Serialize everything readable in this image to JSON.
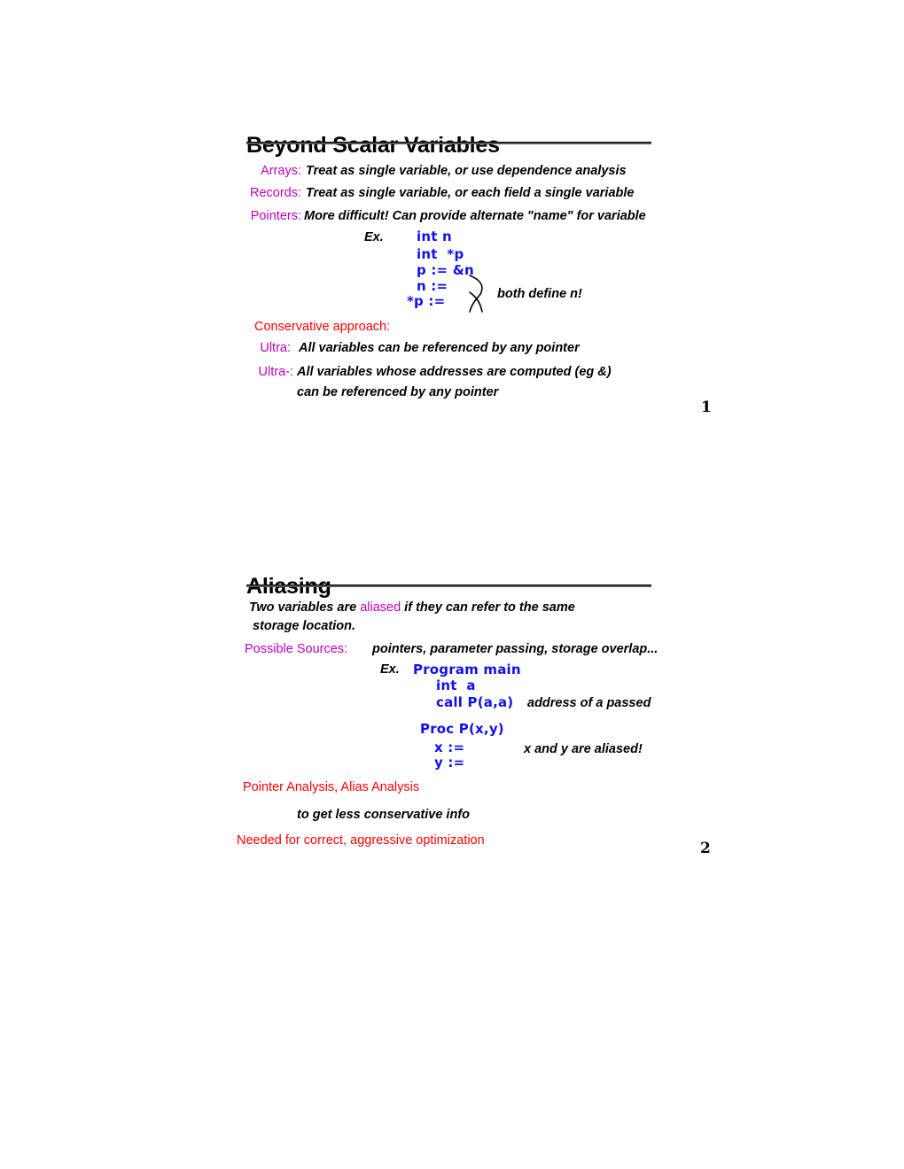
{
  "document": {
    "page_background": "#ffffff",
    "colors": {
      "label_magenta": "#BF00BF",
      "emphasis_red": "#FF0000",
      "code_blue": "#1111EE",
      "body_black": "#000000",
      "rule_gray": "#555555"
    }
  },
  "slides": [
    {
      "title": "Beyond Scalar Variables",
      "page_number": "1",
      "definition_rows": [
        {
          "label": "Arrays:",
          "text": "Treat as single variable, or use dependence analysis"
        },
        {
          "label": "Records:",
          "text": "Treat as single variable, or each field a single variable"
        },
        {
          "label": "Pointers:",
          "text": "More difficult!  Can provide alternate \"name\" for variable"
        }
      ],
      "example": {
        "marker": "Ex.",
        "lines": [
          "int n",
          "int  *p",
          "p := &n",
          "n :=",
          "*p :="
        ],
        "brace_annotation": "both define n!"
      },
      "conservative_heading": "Conservative approach:",
      "conservative_rows": [
        {
          "label": "Ultra:",
          "text": "All variables can be referenced by any pointer"
        },
        {
          "label": "Ultra-:",
          "text": "All variables whose addresses are computed (eg &)"
        }
      ],
      "conservative_continuation": "can be referenced by any pointer"
    },
    {
      "title": "Aliasing",
      "page_number": "2",
      "definition_sentence": {
        "before": "Two variables are ",
        "emphasis": "aliased",
        "after": " if they can refer to the same",
        "second_line": "storage location."
      },
      "sources_row": {
        "label": "Possible Sources:",
        "text": "pointers, parameter passing, storage overlap..."
      },
      "example": {
        "marker": "Ex.",
        "main_lines": [
          "Program main",
          "int  a",
          "call P(a,a)"
        ],
        "main_annotation": "address of a passed",
        "proc_lines": [
          "Proc P(x,y)",
          "x :=",
          "y :="
        ],
        "proc_annotation": "x and y are aliased!"
      },
      "analysis_line": "Pointer Analysis, Alias Analysis",
      "analysis_goal": "to get less conservative  info",
      "closing_line": "Needed for correct, aggressive optimization"
    }
  ]
}
